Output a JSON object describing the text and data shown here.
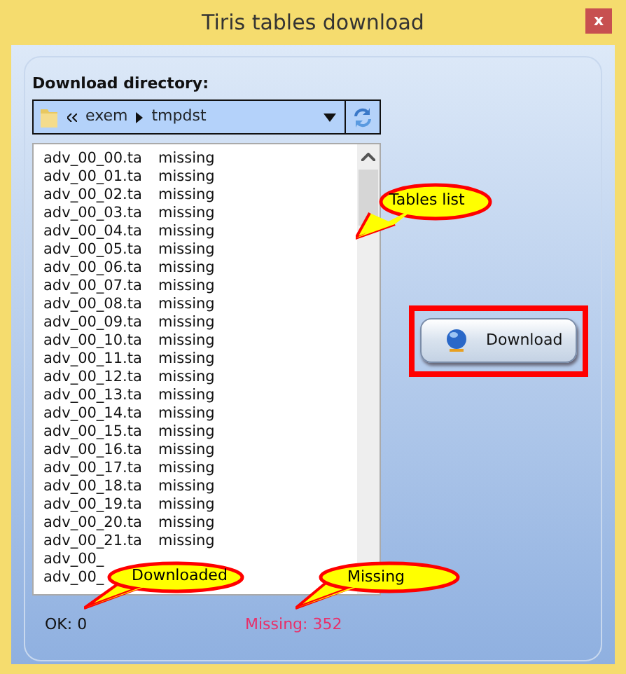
{
  "window": {
    "title": "Tiris tables download",
    "close": "x"
  },
  "directory": {
    "label": "Download directory:",
    "path": [
      "exem",
      "tmpdst"
    ]
  },
  "tables": [
    {
      "name": "adv_00_00.ta",
      "status": "missing"
    },
    {
      "name": "adv_00_01.ta",
      "status": "missing"
    },
    {
      "name": "adv_00_02.ta",
      "status": "missing"
    },
    {
      "name": "adv_00_03.ta",
      "status": "missing"
    },
    {
      "name": "adv_00_04.ta",
      "status": "missing"
    },
    {
      "name": "adv_00_05.ta",
      "status": "missing"
    },
    {
      "name": "adv_00_06.ta",
      "status": "missing"
    },
    {
      "name": "adv_00_07.ta",
      "status": "missing"
    },
    {
      "name": "adv_00_08.ta",
      "status": "missing"
    },
    {
      "name": "adv_00_09.ta",
      "status": "missing"
    },
    {
      "name": "adv_00_10.ta",
      "status": "missing"
    },
    {
      "name": "adv_00_11.ta",
      "status": "missing"
    },
    {
      "name": "adv_00_12.ta",
      "status": "missing"
    },
    {
      "name": "adv_00_13.ta",
      "status": "missing"
    },
    {
      "name": "adv_00_14.ta",
      "status": "missing"
    },
    {
      "name": "adv_00_15.ta",
      "status": "missing"
    },
    {
      "name": "adv_00_16.ta",
      "status": "missing"
    },
    {
      "name": "adv_00_17.ta",
      "status": "missing"
    },
    {
      "name": "adv_00_18.ta",
      "status": "missing"
    },
    {
      "name": "adv_00_19.ta",
      "status": "missing"
    },
    {
      "name": "adv_00_20.ta",
      "status": "missing"
    },
    {
      "name": "adv_00_21.ta",
      "status": "missing"
    },
    {
      "name": "adv_00_"
    },
    {
      "name": "adv_00_"
    }
  ],
  "download_button": {
    "label": "Download"
  },
  "status": {
    "ok": "OK: 0",
    "missing": "Missing: 352"
  },
  "callouts": [
    {
      "kind": "list",
      "text": "Tables list"
    },
    {
      "kind": "ok",
      "text": "Downloaded"
    },
    {
      "kind": "missing",
      "text": "Missing"
    }
  ]
}
